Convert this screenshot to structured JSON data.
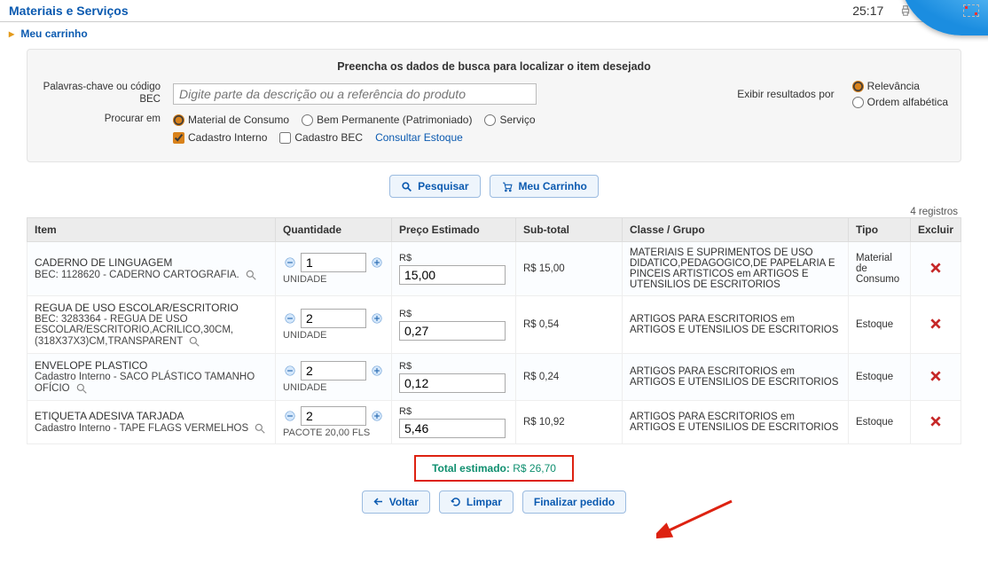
{
  "header": {
    "title": "Materiais e Serviços",
    "timer": "25:17",
    "print_label": "Imprimir"
  },
  "breadcrumb": {
    "label": "Meu carrinho"
  },
  "search": {
    "panel_title": "Preencha os dados de busca para localizar o item desejado",
    "keywords_label": "Palavras-chave ou código BEC",
    "input_placeholder": "Digite parte da descrição ou a referência do produto",
    "procurar_em_label": "Procurar em",
    "opt_consumo": "Material de Consumo",
    "opt_bem": "Bem Permanente (Patrimoniado)",
    "opt_servico": "Serviço",
    "chk_interno": "Cadastro Interno",
    "chk_bec": "Cadastro BEC",
    "link_estoque": "Consultar Estoque",
    "exibir_label": "Exibir resultados por",
    "order_relevancia": "Relevância",
    "order_alfabetica": "Ordem alfabética",
    "btn_pesquisar": "Pesquisar",
    "btn_carrinho": "Meu Carrinho"
  },
  "table": {
    "registros_label": "4 registros",
    "headers": {
      "item": "Item",
      "qtd": "Quantidade",
      "preco": "Preço Estimado",
      "subtotal": "Sub-total",
      "classe": "Classe / Grupo",
      "tipo": "Tipo",
      "excluir": "Excluir"
    },
    "rows": [
      {
        "name": "CADERNO DE LINGUAGEM",
        "sub": "BEC: 1128620 - CADERNO CARTOGRAFIA.",
        "qty": "1",
        "unit": "UNIDADE",
        "price_lbl": "R$",
        "price": "15,00",
        "subtotal": "R$ 15,00",
        "classe": "MATERIAIS E SUPRIMENTOS DE USO DIDATICO,PEDAGOGICO,DE PAPELARIA E PINCEIS ARTISTICOS em ARTIGOS E UTENSILIOS DE ESCRITORIOS",
        "tipo": "Material de Consumo"
      },
      {
        "name": "REGUA DE USO ESCOLAR/ESCRITORIO",
        "sub": "BEC: 3283364 - REGUA DE USO ESCOLAR/ESCRITORIO,ACRILICO,30CM,(318X37X3)CM,TRANSPARENT",
        "qty": "2",
        "unit": "UNIDADE",
        "price_lbl": "R$",
        "price": "0,27",
        "subtotal": "R$ 0,54",
        "classe": "ARTIGOS PARA ESCRITORIOS em ARTIGOS E UTENSILIOS DE ESCRITORIOS",
        "tipo": "Estoque"
      },
      {
        "name": "ENVELOPE PLASTICO",
        "sub": "Cadastro Interno - SACO PLÁSTICO TAMANHO OFÍCIO",
        "qty": "2",
        "unit": "UNIDADE",
        "price_lbl": "R$",
        "price": "0,12",
        "subtotal": "R$ 0,24",
        "classe": "ARTIGOS PARA ESCRITORIOS em ARTIGOS E UTENSILIOS DE ESCRITORIOS",
        "tipo": "Estoque"
      },
      {
        "name": "ETIQUETA ADESIVA TARJADA",
        "sub": "Cadastro Interno - TAPE FLAGS VERMELHOS",
        "qty": "2",
        "unit": "PACOTE 20,00 FLS",
        "price_lbl": "R$",
        "price": "5,46",
        "subtotal": "R$ 10,92",
        "classe": "ARTIGOS PARA ESCRITORIOS em ARTIGOS E UTENSILIOS DE ESCRITORIOS",
        "tipo": "Estoque"
      }
    ]
  },
  "total": {
    "label": "Total estimado:",
    "value": "R$ 26,70"
  },
  "footer": {
    "voltar": "Voltar",
    "limpar": "Limpar",
    "finalizar": "Finalizar pedido"
  }
}
